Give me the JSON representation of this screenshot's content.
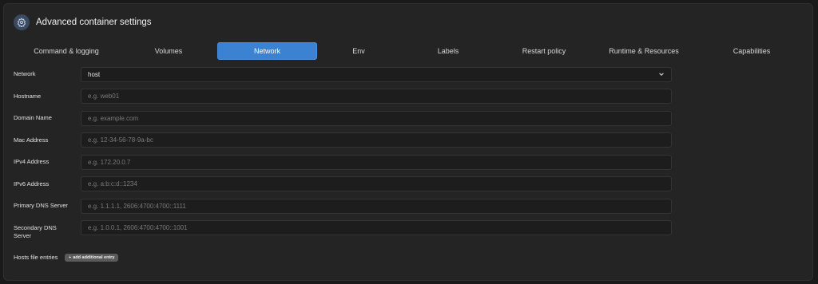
{
  "header": {
    "title": "Advanced container settings",
    "icon": "gear-icon"
  },
  "tabs": [
    {
      "label": "Command & logging"
    },
    {
      "label": "Volumes"
    },
    {
      "label": "Network",
      "active": true
    },
    {
      "label": "Env"
    },
    {
      "label": "Labels"
    },
    {
      "label": "Restart policy"
    },
    {
      "label": "Runtime & Resources"
    },
    {
      "label": "Capabilities"
    }
  ],
  "form": {
    "network": {
      "label": "Network",
      "value": "host"
    },
    "hostname": {
      "label": "Hostname",
      "placeholder": "e.g. web01"
    },
    "domain_name": {
      "label": "Domain Name",
      "placeholder": "e.g. example.com"
    },
    "mac_address": {
      "label": "Mac Address",
      "placeholder": "e.g. 12-34-56-78-9a-bc"
    },
    "ipv4_address": {
      "label": "IPv4 Address",
      "placeholder": "e.g. 172.20.0.7"
    },
    "ipv6_address": {
      "label": "IPv6 Address",
      "placeholder": "e.g. a:b:c:d::1234"
    },
    "primary_dns": {
      "label": "Primary DNS Server",
      "placeholder": "e.g. 1.1.1.1, 2606:4700:4700::1111"
    },
    "secondary_dns": {
      "label": "Secondary DNS Server",
      "placeholder": "e.g. 1.0.0.1, 2606:4700:4700::1001"
    },
    "hosts_file": {
      "label": "Hosts file entries",
      "button_label": "add additional entry"
    }
  },
  "colors": {
    "accent": "#3b83d2",
    "panel": "#242424",
    "input_bg": "#1d1d1d"
  }
}
